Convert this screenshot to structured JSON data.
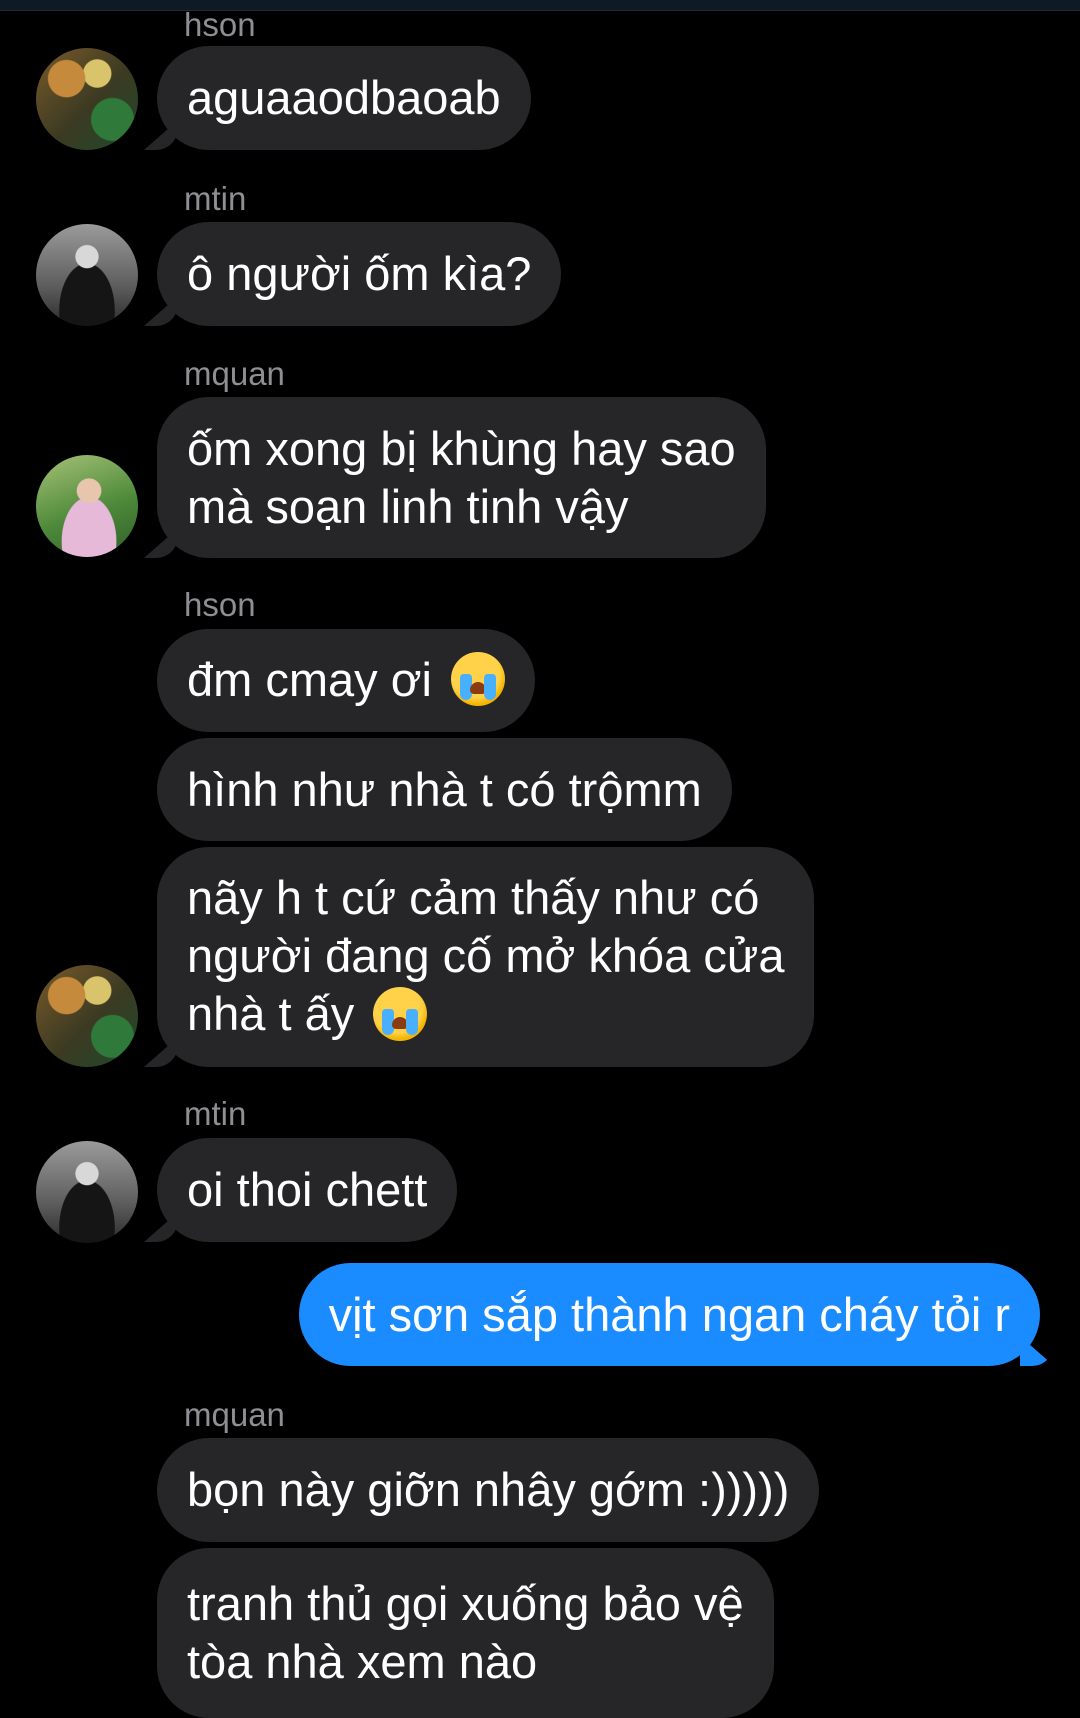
{
  "conversation": {
    "messages": [
      {
        "sender": "hson",
        "text": "aguaaodbaoab"
      },
      {
        "sender": "mtin",
        "text": "ô người ốm kìa?"
      },
      {
        "sender": "mquan",
        "lines": [
          "ốm xong bị khùng hay sao",
          "mà soạn linh tinh vậy"
        ]
      },
      {
        "sender": "hson",
        "text": "đm cmay ơi",
        "emoji": "loudly-crying-face"
      },
      {
        "text": "hình như nhà t có trộmm"
      },
      {
        "lines": [
          "nãy h t cứ cảm thấy như có",
          "người đang cố mở khóa cửa",
          "nhà t ấy"
        ],
        "emoji": "loudly-crying-face"
      },
      {
        "sender": "mtin",
        "text": "oi thoi chett"
      },
      {
        "from_me": true,
        "text": "vịt sơn sắp thành ngan cháy tỏi r"
      },
      {
        "sender": "mquan",
        "text": "bọn này giỡn nhây gớm :)))))"
      },
      {
        "lines": [
          "tranh thủ gọi xuống bảo vệ",
          "tòa nhà xem nào"
        ]
      }
    ],
    "avatars": [
      "hson",
      "mtin",
      "mquan",
      "hson",
      "mtin"
    ]
  },
  "colors": {
    "background": "#000000",
    "incoming_bubble": "#262628",
    "outgoing_bubble": "#1a8cff",
    "sender_name": "#8e8e93"
  }
}
